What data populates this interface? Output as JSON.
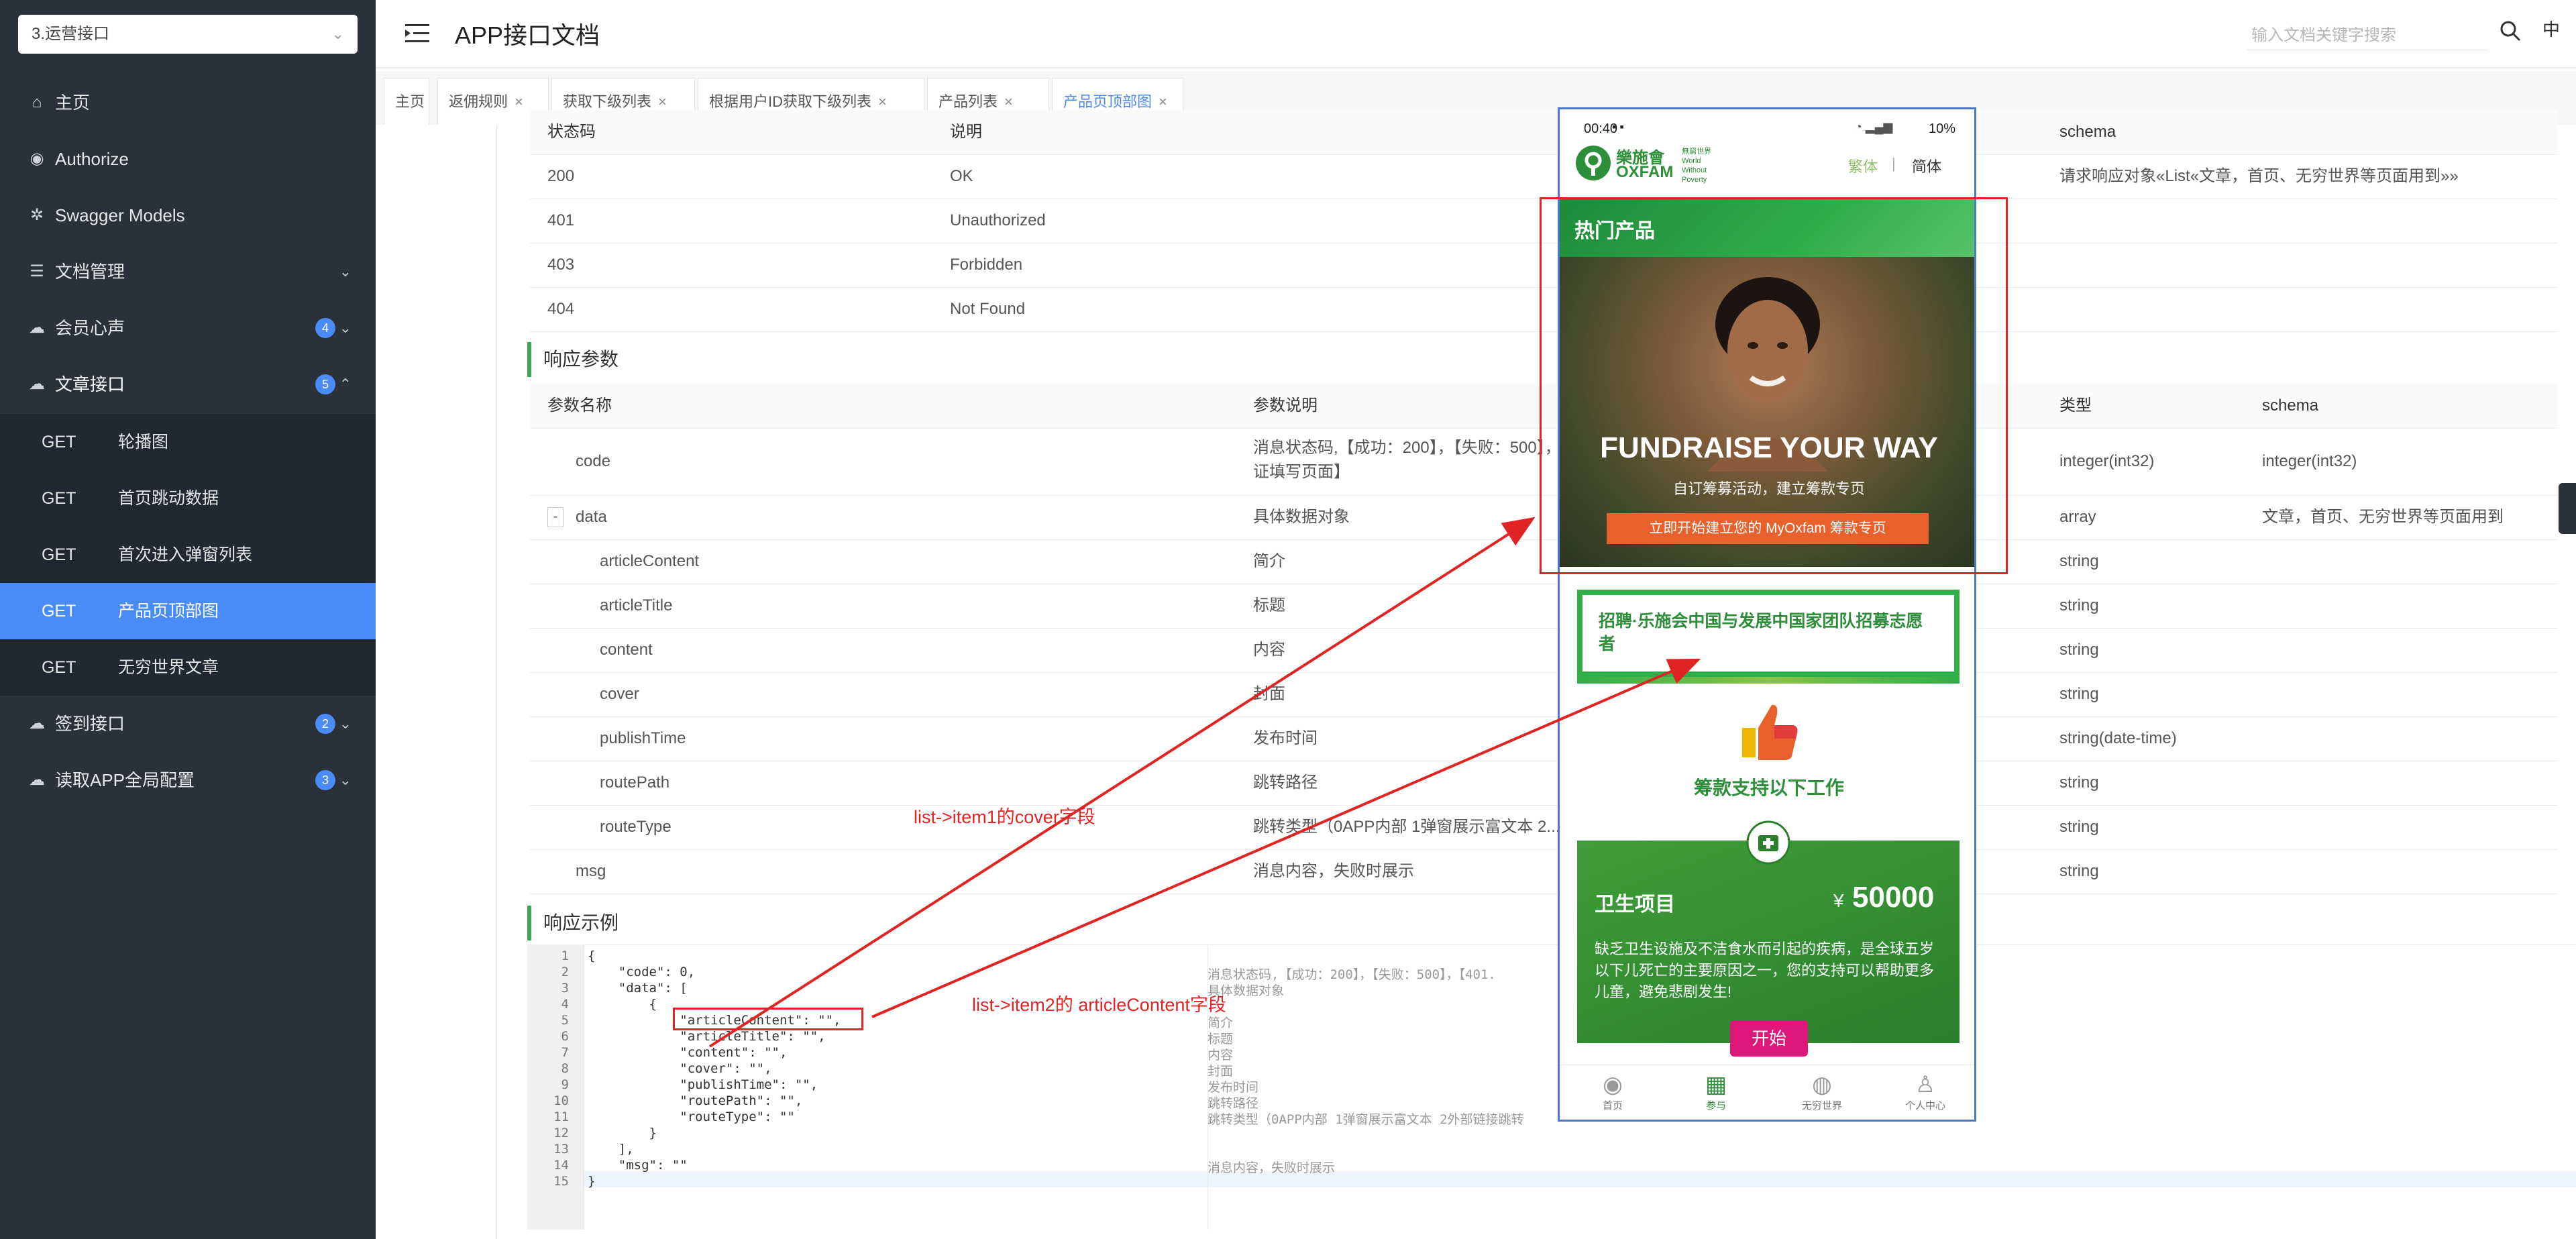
{
  "sidebar": {
    "app_selector": "3.运营接口",
    "items": [
      {
        "label": "主页",
        "icon": "home-icon"
      },
      {
        "label": "Authorize",
        "icon": "lock-icon"
      },
      {
        "label": "Swagger Models",
        "icon": "gear-icon"
      },
      {
        "label": "文档管理",
        "icon": "doc-icon"
      },
      {
        "label": "会员心声",
        "icon": "cloud-icon",
        "badge": "4"
      },
      {
        "label": "文章接口",
        "icon": "cloud-icon",
        "badge": "5"
      },
      {
        "label": "签到接口",
        "icon": "cloud-icon",
        "badge": "2"
      },
      {
        "label": "读取APP全局配置",
        "icon": "cloud-icon",
        "badge": "3"
      }
    ],
    "sub_items": [
      {
        "method": "GET",
        "label": "轮播图"
      },
      {
        "method": "GET",
        "label": "首页跳动数据"
      },
      {
        "method": "GET",
        "label": "首次进入弹窗列表"
      },
      {
        "method": "GET",
        "label": "产品页顶部图"
      },
      {
        "method": "GET",
        "label": "无穷世界文章"
      }
    ]
  },
  "header": {
    "title": "APP接口文档",
    "search_placeholder": "输入文档关键字搜索",
    "lang": "中"
  },
  "tabs": [
    {
      "label": "主页"
    },
    {
      "label": "返佣规则"
    },
    {
      "label": "获取下级列表"
    },
    {
      "label": "根据用户ID获取下级列表"
    },
    {
      "label": "产品列表"
    },
    {
      "label": "产品页顶部图"
    }
  ],
  "status_table": {
    "headers": [
      "状态码",
      "说明",
      "schema"
    ],
    "rows": [
      {
        "code": "200",
        "desc": "OK",
        "schema": "请求响应对象«List«文章，首页、无穷世界等页面用到»»"
      },
      {
        "code": "401",
        "desc": "Unauthorized",
        "schema": ""
      },
      {
        "code": "403",
        "desc": "Forbidden",
        "schema": ""
      },
      {
        "code": "404",
        "desc": "Not Found",
        "schema": ""
      }
    ]
  },
  "response_params": {
    "title": "响应参数",
    "headers": [
      "参数名称",
      "参数说明",
      "类型",
      "schema"
    ],
    "rows": [
      {
        "name": "code",
        "desc": "消息状态码,【成功：200】，【失败：500】，【401...转到身份证填写页面】",
        "type": "integer(int32)",
        "schema": "integer(int32)"
      },
      {
        "name": "data",
        "desc": "具体数据对象",
        "type": "array",
        "schema": "文章，首页、无穷世界等页面用到"
      },
      {
        "name": "articleContent",
        "desc": "简介",
        "type": "string",
        "schema": ""
      },
      {
        "name": "articleTitle",
        "desc": "标题",
        "type": "string",
        "schema": ""
      },
      {
        "name": "content",
        "desc": "内容",
        "type": "string",
        "schema": ""
      },
      {
        "name": "cover",
        "desc": "封面",
        "type": "string",
        "schema": ""
      },
      {
        "name": "publishTime",
        "desc": "发布时间",
        "type": "string(date-time)",
        "schema": ""
      },
      {
        "name": "routePath",
        "desc": "跳转路径",
        "type": "string",
        "schema": ""
      },
      {
        "name": "routeType",
        "desc": "跳转类型（0APP内部 1弹窗展示富文本 2...",
        "type": "string",
        "schema": ""
      },
      {
        "name": "msg",
        "desc": "消息内容，失败时展示",
        "type": "string",
        "schema": ""
      }
    ],
    "desc_line2": "证填写页面】",
    "collapse_toggle": "-"
  },
  "response_example": {
    "title": "响应示例",
    "lines": [
      {
        "n": "1",
        "code": "{",
        "comment": ""
      },
      {
        "n": "2",
        "code": "    \"code\": 0,",
        "comment": "消息状态码,【成功：200】，【失败：500】，【401."
      },
      {
        "n": "3",
        "code": "    \"data\": [",
        "comment": "具体数据对象"
      },
      {
        "n": "4",
        "code": "        {",
        "comment": ""
      },
      {
        "n": "5",
        "code": "            \"articleContent\": \"\",",
        "comment": "简介"
      },
      {
        "n": "6",
        "code": "            \"articleTitle\": \"\",",
        "comment": "标题"
      },
      {
        "n": "7",
        "code": "            \"content\": \"\",",
        "comment": "内容"
      },
      {
        "n": "8",
        "code": "            \"cover\": \"\",",
        "comment": "封面"
      },
      {
        "n": "9",
        "code": "            \"publishTime\": \"\",",
        "comment": "发布时间"
      },
      {
        "n": "10",
        "code": "            \"routePath\": \"\",",
        "comment": "跳转路径"
      },
      {
        "n": "11",
        "code": "            \"routeType\": \"\"",
        "comment": "跳转类型（0APP内部 1弹窗展示富文本 2外部链接跳转"
      },
      {
        "n": "12",
        "code": "        }",
        "comment": ""
      },
      {
        "n": "13",
        "code": "    ],",
        "comment": ""
      },
      {
        "n": "14",
        "code": "    \"msg\": \"\"",
        "comment": "消息内容，失败时展示"
      },
      {
        "n": "15",
        "code": "}",
        "comment": ""
      }
    ]
  },
  "annotations": {
    "label1": "list->item1的cover字段",
    "label2": "list->item2的 articleContent字段"
  },
  "phone": {
    "time": "00:40",
    "battery": "10%",
    "logo_cn": "樂施會",
    "logo_en": "OXFAM",
    "logo_tag": "無窮世界 World Without Poverty",
    "lang_trad": "繁体",
    "lang_sep": "|",
    "lang_simp": "简体",
    "hot_title": "热门产品",
    "hero_big": "FUNDRAISE YOUR WAY",
    "hero_sub": "自订筹募活动，建立筹款专页",
    "hero_btn": "立即开始建立您的 MyOxfam 筹款专页",
    "card2_title": "招聘·乐施会中国与发展中国家团队招募志愿者",
    "support_title": "筹款支持以下工作",
    "project_name": "卫生项目",
    "project_currency": "¥",
    "project_amount": "50000",
    "project_desc": "缺乏卫生设施及不洁食水而引起的疾病，是全球五岁以下儿死亡的主要原因之一，您的支持可以帮助更多儿童，避免悲剧发生!",
    "start_btn": "开始",
    "nav": [
      "首页",
      "参与",
      "无穷世界",
      "个人中心"
    ],
    "colors": {
      "green": "#2e8f3a",
      "accent_orange": "#e8612c",
      "pink": "#e0177a"
    }
  },
  "colors": {
    "sidebar_bg": "#2b3139",
    "active_blue": "#4a8cf7",
    "section_green": "#3aa757",
    "annotation_red": "#e02424"
  }
}
